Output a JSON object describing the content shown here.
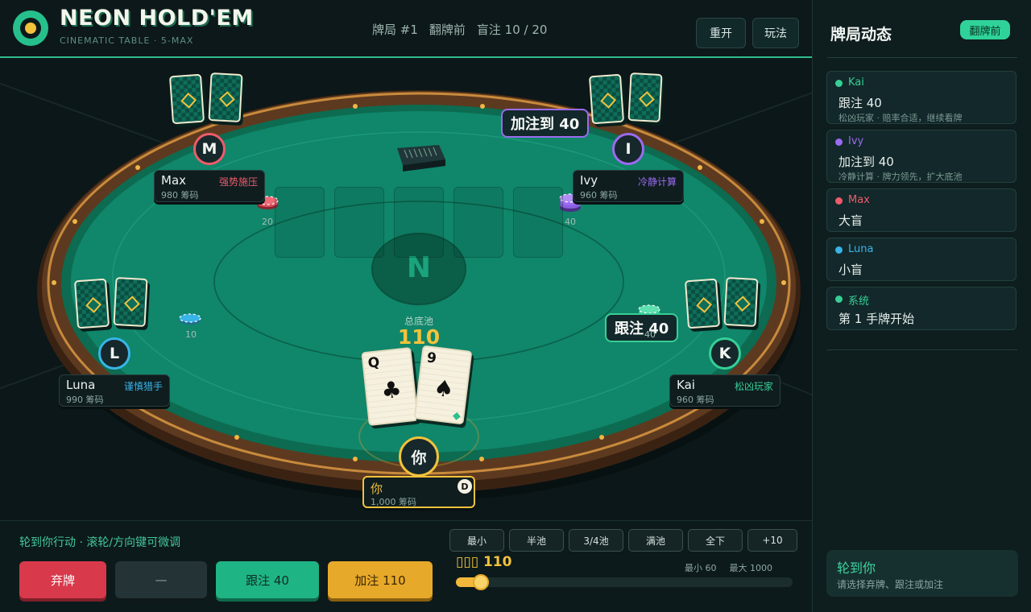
{
  "header": {
    "title": "NEON HOLD'EM",
    "subtitle": "CINEMATIC TABLE · 5-MAX",
    "hand_no": "牌局 #1",
    "stage": "翻牌前",
    "blinds": "盲注 10 / 20",
    "restart_label": "重开",
    "rules_label": "玩法"
  },
  "table": {
    "center_letter": "N",
    "pot_label": "总底池",
    "pot_value": "110",
    "community_cards_dealt": 0
  },
  "players": [
    {
      "id": "max",
      "initial": "M",
      "name": "Max",
      "chips": "980 筹码",
      "style": "强势施压",
      "color": "#ee5b6a",
      "bet": "20"
    },
    {
      "id": "ivy",
      "initial": "I",
      "name": "Ivy",
      "chips": "960 筹码",
      "style": "冷静计算",
      "color": "#9b6bf0",
      "bet": "40",
      "bubble": "加注到 40"
    },
    {
      "id": "luna",
      "initial": "L",
      "name": "Luna",
      "chips": "990 筹码",
      "style": "谨慎猎手",
      "color": "#39b4e8",
      "bet": "10"
    },
    {
      "id": "kai",
      "initial": "K",
      "name": "Kai",
      "chips": "960 筹码",
      "style": "松凶玩家",
      "color": "#36cf96",
      "bet": "40",
      "bubble": "跟注 40"
    },
    {
      "id": "you",
      "initial": "你",
      "name": "你",
      "chips": "1,000 筹码",
      "dealer": "D",
      "color": "#f2c23c"
    }
  ],
  "hero_cards": [
    {
      "rank": "Q",
      "suit": "♣"
    },
    {
      "rank": "9",
      "suit": "♠"
    }
  ],
  "controls": {
    "hint": "轮到你行动 · 滚轮/方向键可微调",
    "fold_label": "弃牌",
    "check_label": "—",
    "call_label": "跟注 40",
    "raise_label": "加注 110",
    "presets": [
      "最小",
      "半池",
      "3/4池",
      "满池",
      "全下",
      "+10"
    ],
    "bet_amount": "▯▯▯ 110",
    "min_label": "最小 60",
    "max_label": "最大 1000",
    "slider_fraction": 0.053
  },
  "sidebar": {
    "title": "牌局动态",
    "phase_badge": "翻牌前",
    "log": [
      {
        "name": "Kai",
        "color": "#36cf96",
        "action": "跟注 40",
        "note": "松凶玩家 · 赔率合适，继续看牌"
      },
      {
        "name": "Ivy",
        "color": "#9b6bf0",
        "action": "加注到 40",
        "note": "冷静计算 · 牌力领先，扩大底池"
      },
      {
        "name": "Max",
        "color": "#ee5b6a",
        "action": "大盲",
        "note": ""
      },
      {
        "name": "Luna",
        "color": "#39b4e8",
        "action": "小盲",
        "note": ""
      },
      {
        "name": "系统",
        "color": "#36cf96",
        "action": "第 1 手牌开始",
        "note": ""
      }
    ],
    "turn_title": "轮到你",
    "turn_sub": "请选择弃牌、跟注或加注"
  }
}
